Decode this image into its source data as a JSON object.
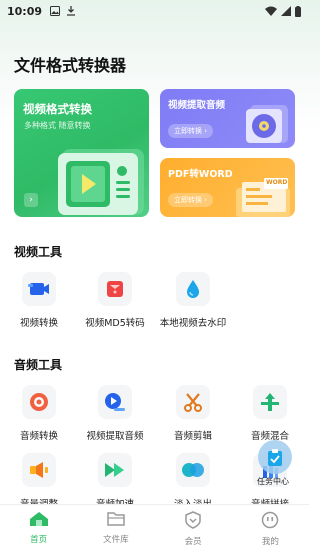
{
  "status_bar": {
    "time": "10:09"
  },
  "page_title": "文件格式转换器",
  "cards": {
    "video": {
      "title": "视频格式转换",
      "subtitle": "多种格式 随意转换",
      "arrow": "›"
    },
    "audio": {
      "title": "视频提取音频",
      "button": "立即转换 ›"
    },
    "pdf": {
      "title": "PDF转WORD",
      "button": "立即转换 ›",
      "doc_tag": "WORD"
    }
  },
  "video_tools": {
    "title": "视频工具",
    "items": [
      {
        "label": "视频转换",
        "icon": "camera-icon"
      },
      {
        "label": "视频MD5转码",
        "icon": "md5-icon"
      },
      {
        "label": "本地视频去水印",
        "icon": "droplet-icon"
      }
    ]
  },
  "audio_tools": {
    "title": "音频工具",
    "items": [
      {
        "label": "音频转换",
        "icon": "record-icon"
      },
      {
        "label": "视频提取音频",
        "icon": "extract-icon"
      },
      {
        "label": "音频剪辑",
        "icon": "scissors-icon"
      },
      {
        "label": "音频混合",
        "icon": "merge-icon"
      },
      {
        "label": "音量调整",
        "icon": "volume-icon"
      },
      {
        "label": "音频加速",
        "icon": "fast-forward-icon"
      },
      {
        "label": "淡入淡出",
        "icon": "fade-icon"
      },
      {
        "label": "音频拼接",
        "icon": "splice-icon"
      }
    ]
  },
  "task_center": {
    "label": "任务中心"
  },
  "bottom_nav": [
    {
      "label": "首页",
      "active": true
    },
    {
      "label": "文件库",
      "active": false
    },
    {
      "label": "会员",
      "active": false
    },
    {
      "label": "我的",
      "active": false
    }
  ],
  "colors": {
    "accent": "#2fba66",
    "audio_card": "#7f7cf5",
    "pdf_card": "#ffae2e"
  }
}
